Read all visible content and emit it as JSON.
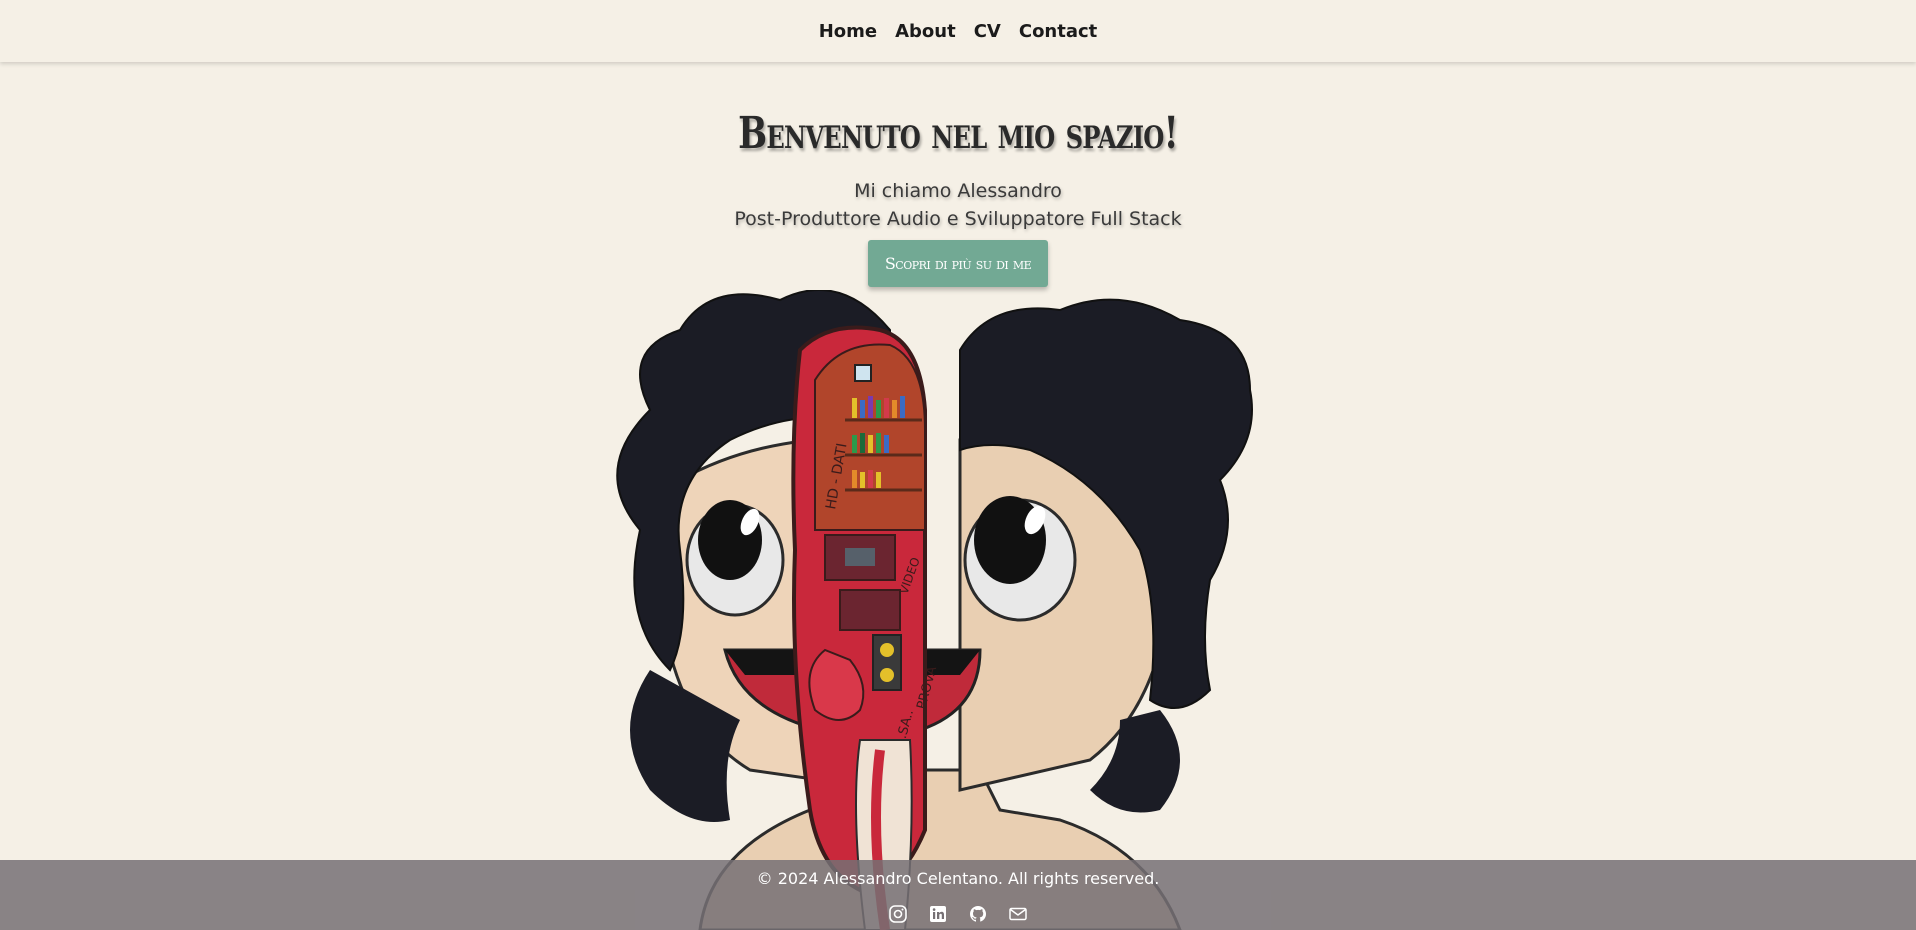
{
  "nav": {
    "items": [
      {
        "label": "Home"
      },
      {
        "label": "About"
      },
      {
        "label": "CV"
      },
      {
        "label": "Contact"
      }
    ]
  },
  "hero": {
    "title": "Benvenuto nel mio spazio!",
    "line1": "Mi chiamo Alessandro",
    "line2": "Post-Produttore Audio e Sviluppatore Full Stack",
    "cta_label": "Scopri di più su di me"
  },
  "illustration": {
    "labels": {
      "hd": "HD - DATI",
      "video": "VIDEO",
      "prova": "PROVA",
      "sasa": "SA..SA.."
    }
  },
  "footer": {
    "copyright": "© 2024 Alessandro Celentano. All rights reserved.",
    "icons": [
      "instagram-icon",
      "linkedin-icon",
      "github-icon",
      "email-icon"
    ]
  },
  "colors": {
    "background": "#f5f0e6",
    "accent": "#72a994",
    "footer": "#767074"
  }
}
